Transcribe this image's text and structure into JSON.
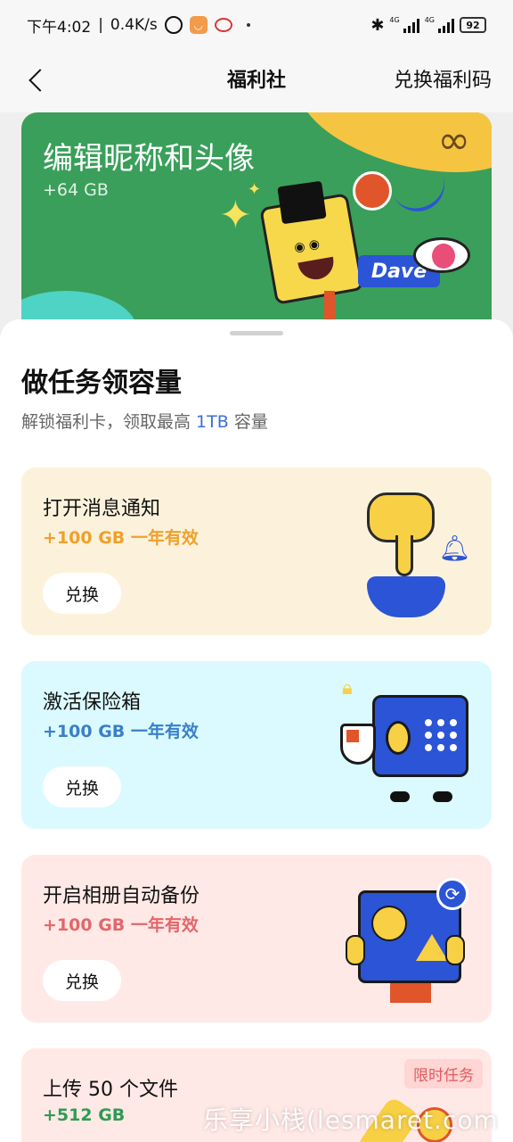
{
  "status_bar": {
    "time": "下午4:02",
    "net_speed": "0.4K/s",
    "net_label_1": "4G",
    "net_label_2": "4G",
    "battery": "92"
  },
  "nav": {
    "title": "福利社",
    "action": "兑换福利码"
  },
  "banner": {
    "title": "编辑昵称和头像",
    "reward": "+64 GB",
    "badge_text": "Dave"
  },
  "sheet": {
    "title": "做任务领容量",
    "subtitle_prefix": "解锁福利卡，领取最高 ",
    "subtitle_highlight": "1TB",
    "subtitle_suffix": " 容量"
  },
  "tasks": [
    {
      "title": "打开消息通知",
      "reward": "+100 GB  一年有效",
      "button": "兑换",
      "illustration": "finger-press-button"
    },
    {
      "title": "激活保险箱",
      "reward": "+100 GB  一年有效",
      "button": "兑换",
      "illustration": "safe-box"
    },
    {
      "title": "开启相册自动备份",
      "reward": "+100 GB  一年有效",
      "button": "兑换",
      "illustration": "photo-album-sync"
    },
    {
      "title": "上传 50 个文件",
      "reward": "+512 GB",
      "tag": "限时任务",
      "illustration": "phone-pizza"
    }
  ],
  "watermark": "乐享小栈(lesmaret.com",
  "colors": {
    "banner_bg": "#3a9f5a",
    "card1_bg": "#fcf2dc",
    "card1_accent": "#f0a02a",
    "card2_bg": "#dafaff",
    "card2_accent": "#3a7fc9",
    "card3_bg": "#ffe9e6",
    "card3_accent": "#e3666a",
    "card4_accent": "#2f9c52",
    "highlight": "#3b6fd8"
  }
}
